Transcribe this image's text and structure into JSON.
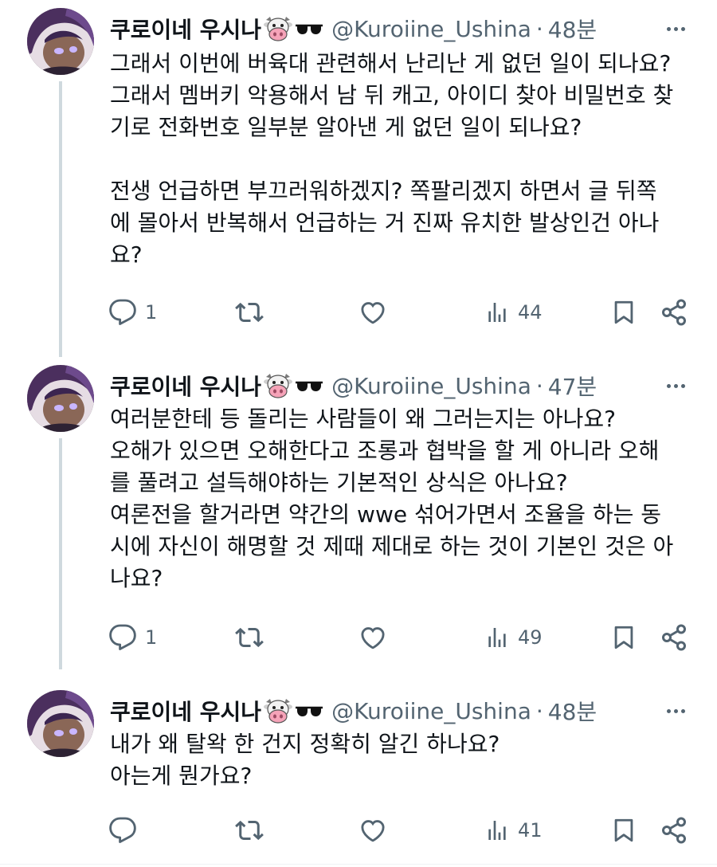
{
  "tweets": [
    {
      "name": "쿠로이네 우시나",
      "handle": "@Kuroiine_Ushina",
      "separator": "·",
      "time": "48분",
      "lines": [
        "그래서 이번에 버육대 관련해서 난리난 게 없던 일이 되나요?",
        "그래서 멤버키 악용해서 남 뒤 캐고, 아이디 찾아 비밀번호 찾",
        "기로 전화번호 일부분 알아낸 게 없던 일이 되나요?",
        "",
        "전생 언급하면 부끄러워하겠지? 쪽팔리겠지 하면서 글 뒤쪽",
        "에 몰아서 반복해서 언급하는 거 진짜 유치한 발상인건 아나",
        "요?"
      ],
      "replies": "1",
      "retweets": "",
      "likes": "",
      "views": "44"
    },
    {
      "name": "쿠로이네 우시나",
      "handle": "@Kuroiine_Ushina",
      "separator": "·",
      "time": "47분",
      "lines": [
        "여러분한테 등 돌리는 사람들이 왜 그러는지는 아나요?",
        "오해가 있으면 오해한다고 조롱과 협박을 할 게 아니라 오해",
        "를 풀려고 설득해야하는 기본적인 상식은 아나요?",
        "여론전을 할거라면 약간의 wwe 섞어가면서 조율을 하는 동",
        "시에 자신이 해명할 것 제때 제대로 하는 것이 기본인 것은 아",
        "나요?"
      ],
      "replies": "1",
      "retweets": "",
      "likes": "",
      "views": "49"
    },
    {
      "name": "쿠로이네 우시나",
      "handle": "@Kuroiine_Ushina",
      "separator": "·",
      "time": "48분",
      "lines": [
        "내가 왜 탈왁 한 건지 정확히 알긴 하나요?",
        "아는게 뭔가요?"
      ],
      "replies": "",
      "retweets": "",
      "likes": "",
      "views": "41"
    }
  ],
  "icons": {
    "name_emoji_1": "cow-face-icon",
    "name_emoji_2": "sunglasses-icon",
    "reply": "reply-icon",
    "retweet": "retweet-icon",
    "like": "heart-icon",
    "views": "views-bar-chart-icon",
    "bookmark": "bookmark-icon",
    "share": "share-icon",
    "more": "more-dots-icon"
  },
  "colors": {
    "text": "#0f1419",
    "secondary": "#536471",
    "thread_line": "#cfd9de",
    "background": "#ffffff"
  }
}
